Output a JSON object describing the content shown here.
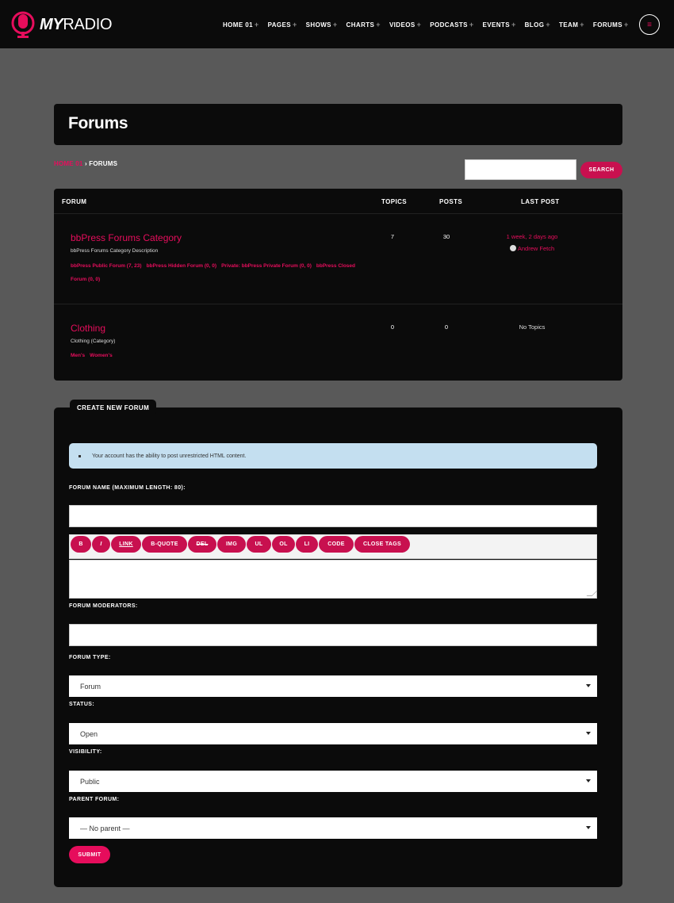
{
  "header": {
    "logo_bold": "MY",
    "logo_light": "RADIO",
    "nav": [
      "HOME 01",
      "PAGES",
      "SHOWS",
      "CHARTS",
      "VIDEOS",
      "PODCASTS",
      "EVENTS",
      "BLOG",
      "TEAM",
      "FORUMS"
    ],
    "nav_plus": "+",
    "menu_icon": "≡"
  },
  "page": {
    "title": "Forums",
    "breadcrumb_home": "HOME 01",
    "breadcrumb_sep": "›",
    "breadcrumb_current": "FORUMS",
    "search_label": "SEARCH"
  },
  "table": {
    "headers": {
      "forum": "FORUM",
      "topics": "TOPICS",
      "posts": "POSTS",
      "last_post": "LAST POST"
    },
    "rows": [
      {
        "title": "bbPress Forums Category",
        "description": "bbPress Forums Category Description",
        "subforums": [
          "bbPress Public Forum (7, 23)",
          "bbPress Hidden Forum (0, 0)",
          "Private: bbPress Private Forum (0, 0)",
          "bbPress Closed Forum (0, 0)"
        ],
        "topics": "7",
        "posts": "30",
        "last_post_time": "1 week, 2 days ago",
        "last_post_author": "Andrew Fetch"
      },
      {
        "title": "Clothing",
        "description": "Clothing (Category)",
        "subforums": [
          "Men's",
          "Women's"
        ],
        "topics": "0",
        "posts": "0",
        "last_post_none": "No Topics"
      }
    ]
  },
  "form": {
    "legend": "CREATE NEW FORUM",
    "notice": "Your account has the ability to post unrestricted HTML content.",
    "forum_name_label": "FORUM NAME (MAXIMUM LENGTH: 80):",
    "toolbar": [
      "B",
      "I",
      "LINK",
      "B-QUOTE",
      "DEL",
      "IMG",
      "UL",
      "OL",
      "LI",
      "CODE",
      "CLOSE TAGS"
    ],
    "moderators_label": "FORUM MODERATORS:",
    "type_label": "FORUM TYPE:",
    "type_value": "Forum",
    "status_label": "STATUS:",
    "status_value": "Open",
    "visibility_label": "VISIBILITY:",
    "visibility_value": "Public",
    "parent_label": "PARENT FORUM:",
    "parent_value": "— No parent —",
    "submit_label": "SUBMIT"
  },
  "colors": {
    "accent": "#e60d5c",
    "button": "#c8104f",
    "panel": "#0b0b0b",
    "background": "#595959",
    "notice": "#c4dff0"
  }
}
